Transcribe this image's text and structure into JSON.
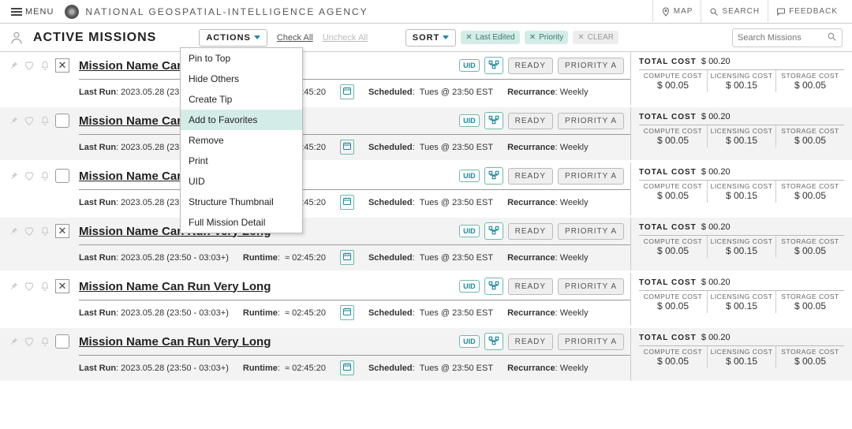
{
  "topbar": {
    "menu": "MENU",
    "title": "NATIONAL GEOSPATIAL-INTELLIGENCE AGENCY",
    "map": "MAP",
    "search": "SEARCH",
    "feedback": "FEEDBACK"
  },
  "toolbar": {
    "page_title": "ACTIVE MISSIONS",
    "actions": "ACTIONS",
    "check_all": "Check All",
    "uncheck_all": "Uncheck All",
    "sort": "SORT",
    "chip_last_edited": "Last Edited",
    "chip_priority": "Priority",
    "chip_clear": "CLEAR",
    "search_placeholder": "Search Missions"
  },
  "dropdown": {
    "items": [
      "Pin to Top",
      "Hide Others",
      "Create Tip",
      "Add to Favorites",
      "Remove",
      "Print",
      "UID",
      "Structure Thumbnail",
      "Full Mission Detail"
    ],
    "highlight_index": 3
  },
  "mission": {
    "name": "Mission Name Can Run Very Long",
    "uid": "UID",
    "ready": "READY",
    "priority": "PRIORITY A",
    "last_run_label": "Last Run",
    "last_run_value": "2023.05.28 (23:50 - 03:03+)",
    "runtime_label": "Runtime",
    "runtime_value": "≈ 02:45:20",
    "scheduled_label": "Scheduled",
    "scheduled_value": "Tues @ 23:50 EST",
    "recurrence_label": "Recurrance",
    "recurrence_value": "Weekly"
  },
  "costs": {
    "total_label": "TOTAL COST",
    "total_value": "$ 00.20",
    "compute_label": "COMPUTE COST",
    "compute_value": "$ 00.05",
    "licensing_label": "LICENSING COST",
    "licensing_value": "$ 00.15",
    "storage_label": "STORAGE COST",
    "storage_value": "$ 00.05"
  },
  "rows": [
    {
      "x": true,
      "alt": false
    },
    {
      "x": false,
      "alt": true
    },
    {
      "x": false,
      "alt": false
    },
    {
      "x": true,
      "alt": true
    },
    {
      "x": true,
      "alt": false
    },
    {
      "x": false,
      "alt": true
    }
  ]
}
